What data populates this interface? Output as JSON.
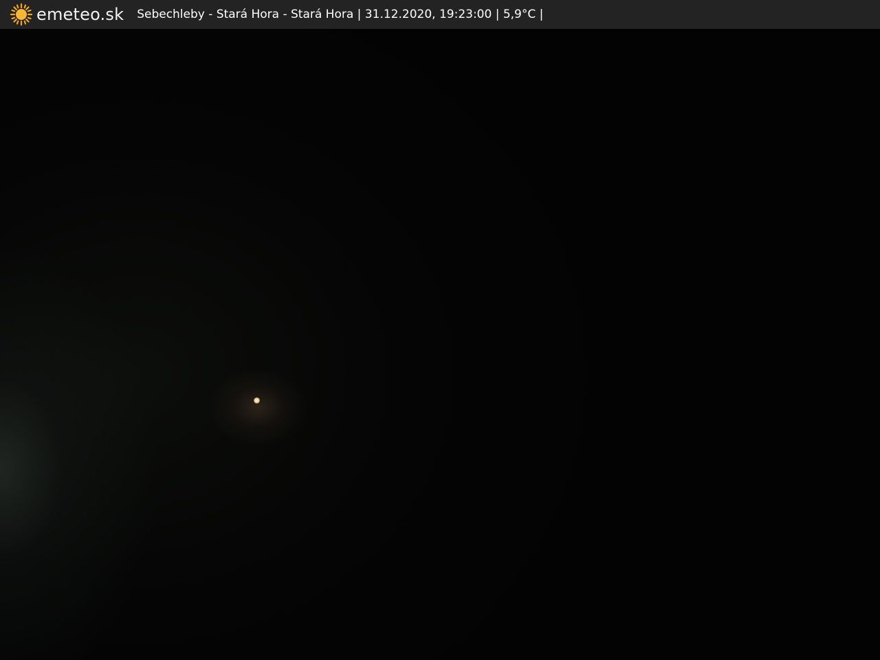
{
  "header": {
    "brand": "emeteo.sk",
    "logo_icon": "sun-icon",
    "caption": "Sebechleby - Stará Hora - Stará Hora | 31.12.2020, 19:23:00 | 5,9°C |"
  },
  "colors": {
    "header_bg": "#232323",
    "sun": "#f5a623",
    "text": "#ffffff",
    "scene": "#000000"
  }
}
